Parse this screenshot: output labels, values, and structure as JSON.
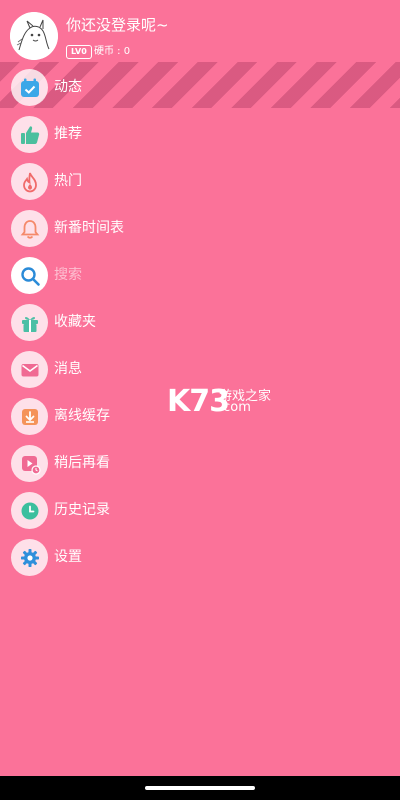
{
  "header": {
    "login_prompt": "你还没登录呢~",
    "level_badge": "LV0",
    "coins": "硬币 : 0"
  },
  "menu": {
    "items": [
      {
        "label": "动态",
        "icon": "calendar-check-icon",
        "color": "#3CA7E8"
      },
      {
        "label": "推荐",
        "icon": "thumbs-up-icon",
        "color": "#4BBF9E"
      },
      {
        "label": "热门",
        "icon": "flame-icon",
        "color": "#F06A6A"
      },
      {
        "label": "新番时间表",
        "icon": "bell-icon",
        "color": "#F5896A"
      },
      {
        "label": "搜索",
        "icon": "search-icon",
        "color": "#2A8BD8"
      },
      {
        "label": "收藏夹",
        "icon": "gift-box-icon",
        "color": "#4BBFA5"
      },
      {
        "label": "消息",
        "icon": "mail-icon",
        "color": "#F06A93"
      },
      {
        "label": "离线缓存",
        "icon": "download-icon",
        "color": "#F5935A"
      },
      {
        "label": "稍后再看",
        "icon": "play-later-icon",
        "color": "#F06A93"
      },
      {
        "label": "历史记录",
        "icon": "clock-icon",
        "color": "#3CBF9E"
      },
      {
        "label": "设置",
        "icon": "gear-icon",
        "color": "#2F8FDB"
      }
    ]
  },
  "watermark": {
    "brand": "K73",
    "line1": "游戏之家",
    "line2": ".com"
  },
  "colors": {
    "background": "#FB7299",
    "text": "#FFFFFF"
  }
}
